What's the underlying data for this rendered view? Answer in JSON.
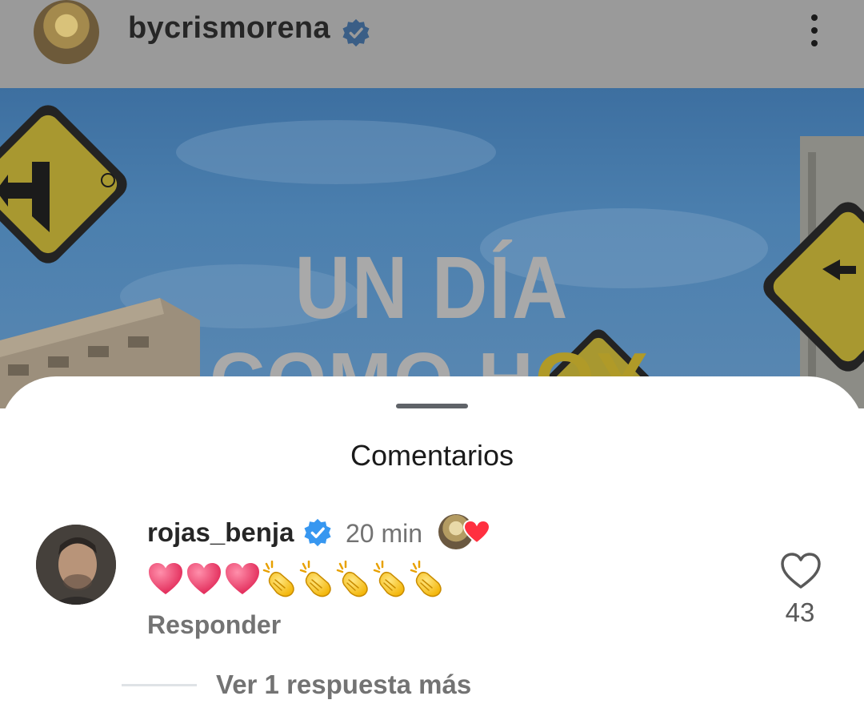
{
  "header": {
    "username": "bycrismorena",
    "verified_icon": "verified-badge-icon",
    "more_icon": "more-vertical-icon"
  },
  "post": {
    "title_line1": "UN DÍA",
    "title_line2_visible": "COMO H",
    "title_line2_accent": "OY"
  },
  "comments_sheet": {
    "title": "Comentarios",
    "comment": {
      "username": "rojas_benja",
      "verified": true,
      "time": "20 min",
      "liked_by_author": true,
      "emoji_text": "❤️❤️❤️👏👏👏👏👏",
      "reply_label": "Responder",
      "like_count": "43"
    },
    "view_more_replies": "Ver 1 respuesta más"
  },
  "colors": {
    "verified_blue": "#3797f0",
    "heart_red": "#ff3040",
    "secondary_text": "#737373",
    "primary_text": "#262626"
  }
}
